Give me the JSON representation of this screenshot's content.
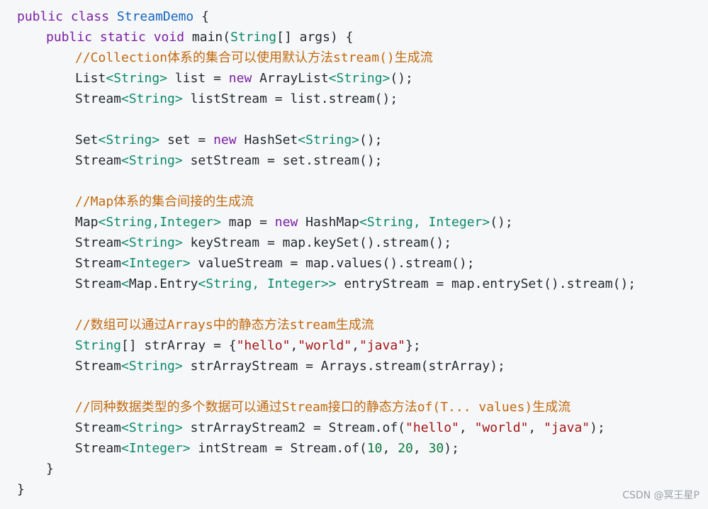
{
  "code": {
    "language": "java",
    "colors": {
      "keyword": "#7b1fa2",
      "type": "#0b8a6b",
      "class": "#1565c0",
      "plain": "#24292e",
      "string": "#a31515",
      "number": "#0b7a3e",
      "comment": "#c06a10"
    },
    "lines": [
      {
        "indent": 0,
        "tokens": [
          [
            "keyword",
            "public class "
          ],
          [
            "class",
            "StreamDemo"
          ],
          [
            "plain",
            " {"
          ]
        ]
      },
      {
        "indent": 1,
        "tokens": [
          [
            "keyword",
            "public static void "
          ],
          [
            "plain",
            "main("
          ],
          [
            "type",
            "String"
          ],
          [
            "plain",
            "[] args) {"
          ]
        ]
      },
      {
        "indent": 2,
        "tokens": [
          [
            "comment",
            "//Collection体系的集合可以使用默认方法stream()生成流"
          ]
        ]
      },
      {
        "indent": 2,
        "tokens": [
          [
            "plain",
            "List"
          ],
          [
            "type",
            "<String>"
          ],
          [
            "plain",
            " list = "
          ],
          [
            "keyword",
            "new "
          ],
          [
            "plain",
            "ArrayList"
          ],
          [
            "type",
            "<String>"
          ],
          [
            "plain",
            "();"
          ]
        ]
      },
      {
        "indent": 2,
        "tokens": [
          [
            "plain",
            "Stream"
          ],
          [
            "type",
            "<String>"
          ],
          [
            "plain",
            " listStream = list.stream();"
          ]
        ]
      },
      {
        "indent": 0,
        "tokens": []
      },
      {
        "indent": 2,
        "tokens": [
          [
            "plain",
            "Set"
          ],
          [
            "type",
            "<String>"
          ],
          [
            "plain",
            " set = "
          ],
          [
            "keyword",
            "new "
          ],
          [
            "plain",
            "HashSet"
          ],
          [
            "type",
            "<String>"
          ],
          [
            "plain",
            "();"
          ]
        ]
      },
      {
        "indent": 2,
        "tokens": [
          [
            "plain",
            "Stream"
          ],
          [
            "type",
            "<String>"
          ],
          [
            "plain",
            " setStream = set.stream();"
          ]
        ]
      },
      {
        "indent": 0,
        "tokens": []
      },
      {
        "indent": 2,
        "tokens": [
          [
            "comment",
            "//Map体系的集合间接的生成流"
          ]
        ]
      },
      {
        "indent": 2,
        "tokens": [
          [
            "plain",
            "Map"
          ],
          [
            "type",
            "<String,Integer>"
          ],
          [
            "plain",
            " map = "
          ],
          [
            "keyword",
            "new "
          ],
          [
            "plain",
            "HashMap"
          ],
          [
            "type",
            "<String, Integer>"
          ],
          [
            "plain",
            "();"
          ]
        ]
      },
      {
        "indent": 2,
        "tokens": [
          [
            "plain",
            "Stream"
          ],
          [
            "type",
            "<String>"
          ],
          [
            "plain",
            " keyStream = map.keySet().stream();"
          ]
        ]
      },
      {
        "indent": 2,
        "tokens": [
          [
            "plain",
            "Stream"
          ],
          [
            "type",
            "<Integer>"
          ],
          [
            "plain",
            " valueStream = map.values().stream();"
          ]
        ]
      },
      {
        "indent": 2,
        "tokens": [
          [
            "plain",
            "Stream"
          ],
          [
            "type",
            "<"
          ],
          [
            "plain",
            "Map.Entry"
          ],
          [
            "type",
            "<String, Integer>>"
          ],
          [
            "plain",
            " entryStream = map.entrySet().stream();"
          ]
        ]
      },
      {
        "indent": 0,
        "tokens": []
      },
      {
        "indent": 2,
        "tokens": [
          [
            "comment",
            "//数组可以通过Arrays中的静态方法stream生成流"
          ]
        ]
      },
      {
        "indent": 2,
        "tokens": [
          [
            "type",
            "String"
          ],
          [
            "plain",
            "[] strArray = {"
          ],
          [
            "string",
            "\"hello\""
          ],
          [
            "plain",
            ","
          ],
          [
            "string",
            "\"world\""
          ],
          [
            "plain",
            ","
          ],
          [
            "string",
            "\"java\""
          ],
          [
            "plain",
            "};"
          ]
        ]
      },
      {
        "indent": 2,
        "tokens": [
          [
            "plain",
            "Stream"
          ],
          [
            "type",
            "<String>"
          ],
          [
            "plain",
            " strArrayStream = Arrays.stream(strArray);"
          ]
        ]
      },
      {
        "indent": 0,
        "tokens": []
      },
      {
        "indent": 2,
        "tokens": [
          [
            "comment",
            "//同种数据类型的多个数据可以通过Stream接口的静态方法of(T... values)生成流"
          ]
        ]
      },
      {
        "indent": 2,
        "tokens": [
          [
            "plain",
            "Stream"
          ],
          [
            "type",
            "<String>"
          ],
          [
            "plain",
            " strArrayStream2 = Stream.of("
          ],
          [
            "string",
            "\"hello\""
          ],
          [
            "plain",
            ", "
          ],
          [
            "string",
            "\"world\""
          ],
          [
            "plain",
            ", "
          ],
          [
            "string",
            "\"java\""
          ],
          [
            "plain",
            ");"
          ]
        ]
      },
      {
        "indent": 2,
        "tokens": [
          [
            "plain",
            "Stream"
          ],
          [
            "type",
            "<Integer>"
          ],
          [
            "plain",
            " intStream = Stream.of("
          ],
          [
            "number",
            "10"
          ],
          [
            "plain",
            ", "
          ],
          [
            "number",
            "20"
          ],
          [
            "plain",
            ", "
          ],
          [
            "number",
            "30"
          ],
          [
            "plain",
            ");"
          ]
        ]
      },
      {
        "indent": 1,
        "tokens": [
          [
            "plain",
            "}"
          ]
        ]
      },
      {
        "indent": 0,
        "tokens": [
          [
            "plain",
            "}"
          ]
        ]
      }
    ]
  },
  "watermark": "CSDN @冥王星P"
}
